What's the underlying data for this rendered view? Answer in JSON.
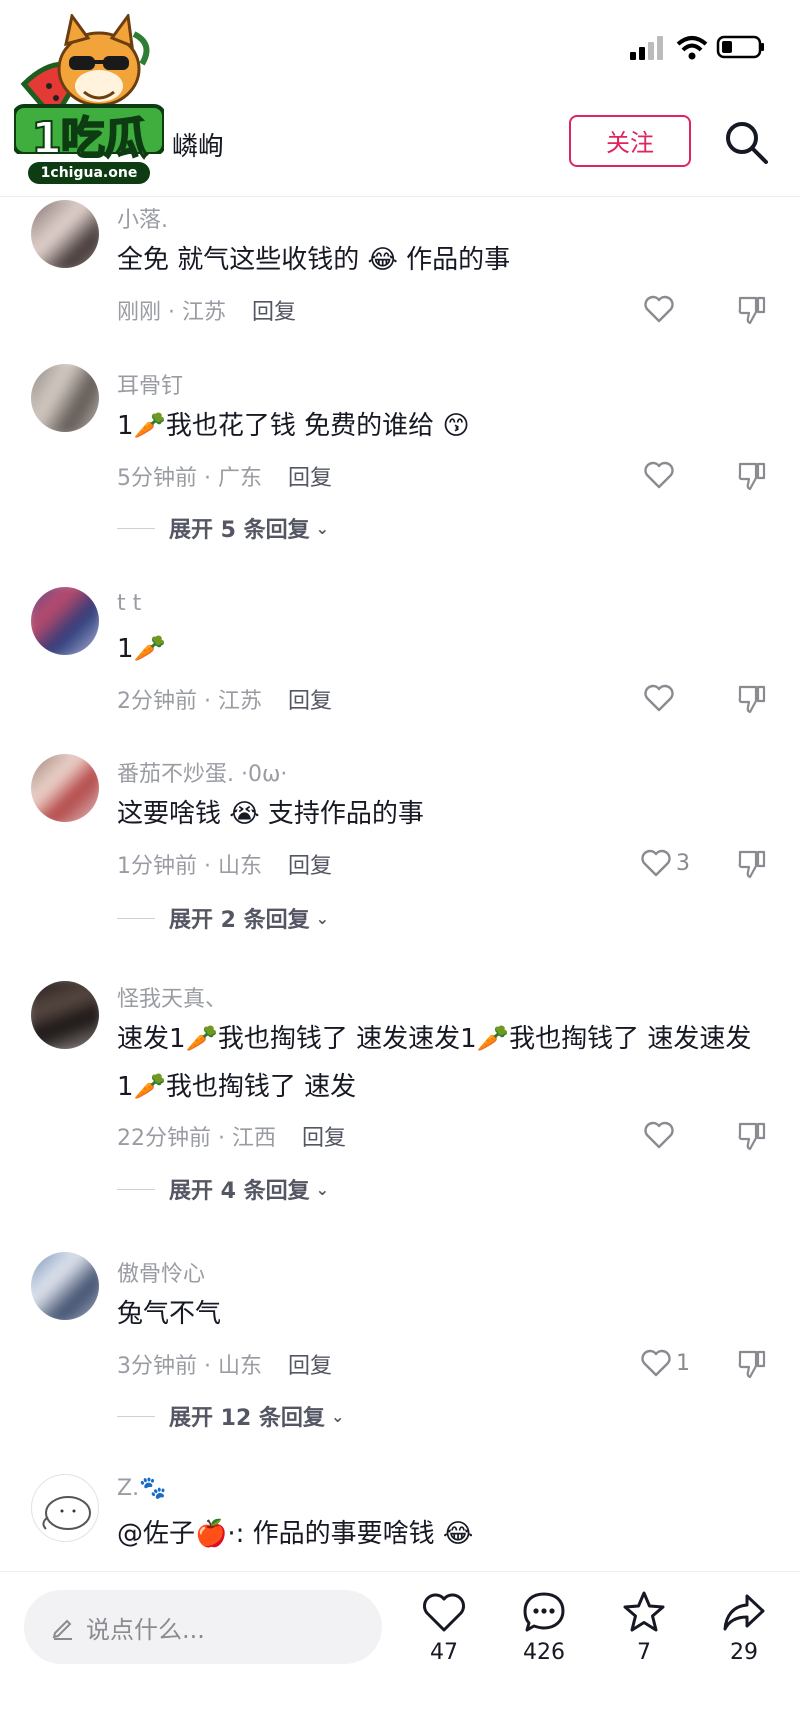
{
  "header": {
    "logo_text": "1吃瓜",
    "logo_domain": "1chigua.one",
    "channel_name": "嶙峋",
    "follow_label": "关注"
  },
  "comments": [
    {
      "username": "小落.",
      "text": "全免 就气这些收钱的 😂 作品的事",
      "time_loc": "刚刚 · 江苏",
      "reply": "回复",
      "likes": ""
    },
    {
      "username": "耳骨钉",
      "text": "1🥕我也花了钱 免费的谁给 😙",
      "time_loc": "5分钟前 · 广东",
      "reply": "回复",
      "likes": "",
      "expand": "展开 5 条回复"
    },
    {
      "username": "t t",
      "text": "1🥕",
      "time_loc": "2分钟前 · 江苏",
      "reply": "回复",
      "likes": ""
    },
    {
      "username": "番茄不炒蛋. ·0ω·",
      "text": "这要啥钱 😭 支持作品的事",
      "time_loc": "1分钟前 · 山东",
      "reply": "回复",
      "likes": "3",
      "expand": "展开 2 条回复"
    },
    {
      "username": "怪我天真、",
      "text": "速发1🥕我也掏钱了  速发速发1🥕我也掏钱了  速发速发1🥕我也掏钱了  速发",
      "time_loc": "22分钟前 · 江西",
      "reply": "回复",
      "likes": "",
      "expand": "展开 4 条回复"
    },
    {
      "username": "傲骨怜心",
      "text": "兔气不气",
      "time_loc": "3分钟前 · 山东",
      "reply": "回复",
      "likes": "1",
      "expand": "展开 12 条回复"
    },
    {
      "username": "Z.🐾",
      "text": "@佐子🍎·: 作品的事要啥钱 😂"
    }
  ],
  "bottom": {
    "input_placeholder": "说点什么...",
    "like_count": "47",
    "comment_count": "426",
    "star_count": "7",
    "share_count": "29"
  },
  "colors": {
    "accent": "#e0245e",
    "secondary_text": "#9a9ca3",
    "primary_text": "#161823"
  }
}
